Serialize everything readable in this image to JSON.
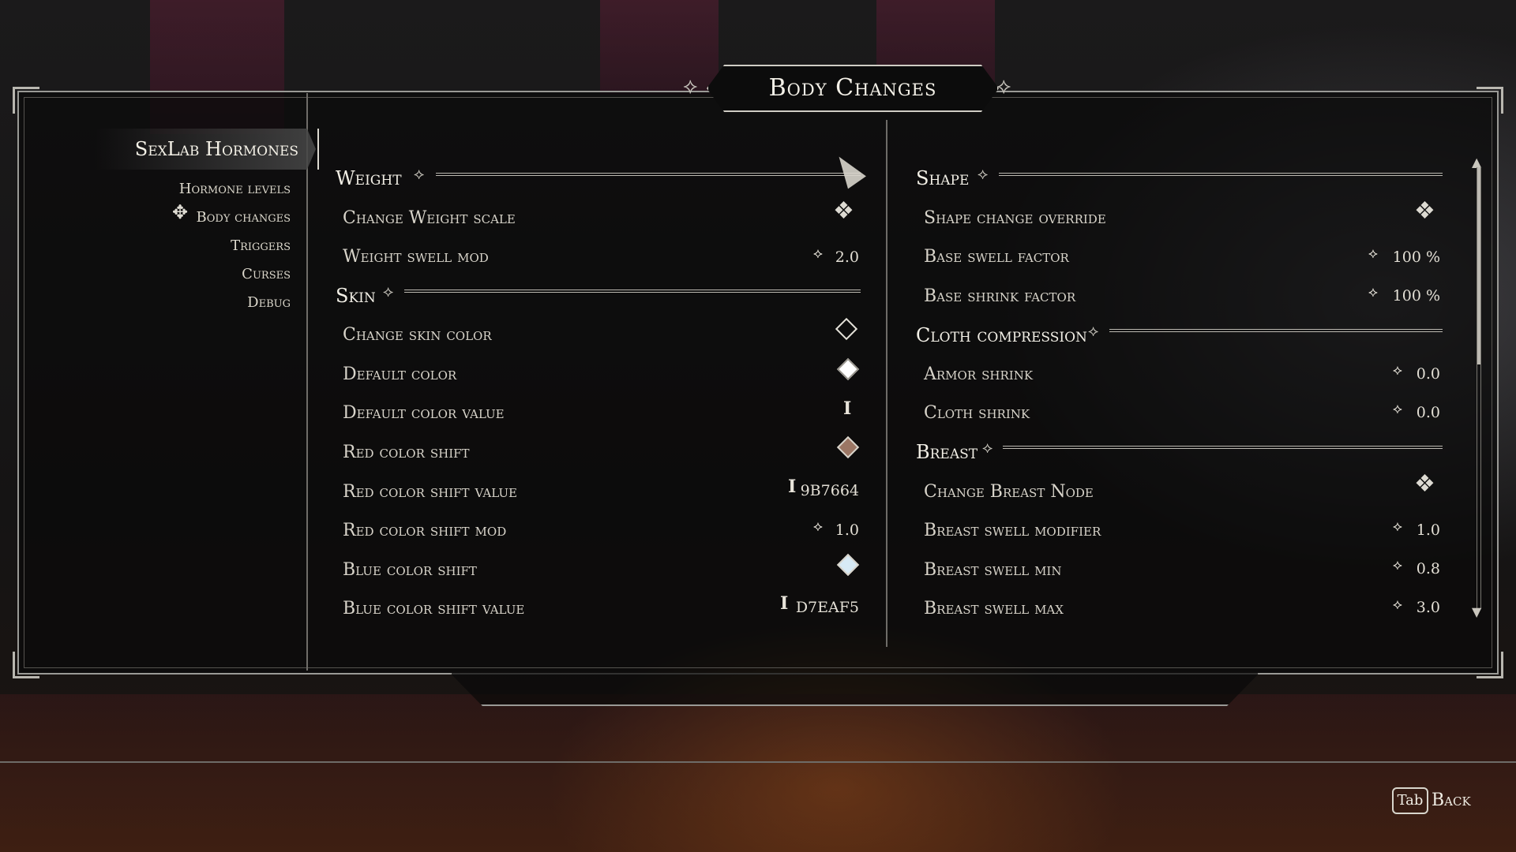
{
  "title": "Body Changes",
  "sidebar": {
    "active_mod": "SexLab Hormones",
    "pages": [
      "Hormone levels",
      "Body changes",
      "Triggers",
      "Curses",
      "Debug"
    ]
  },
  "left": {
    "weight": {
      "header": "Weight",
      "options": [
        {
          "label": "Change Weight scale",
          "value": ""
        },
        {
          "label": "Weight swell mod",
          "value": "2.0"
        }
      ]
    },
    "skin": {
      "header": "Skin",
      "options": [
        {
          "label": "Change skin color",
          "value": ""
        },
        {
          "label": "Default color",
          "value": ""
        },
        {
          "label": "Default color value",
          "value": ""
        },
        {
          "label": "Red color shift",
          "value": ""
        },
        {
          "label": "Red color shift value",
          "value": "9B7664"
        },
        {
          "label": "Red color shift mod",
          "value": "1.0"
        },
        {
          "label": "Blue color shift",
          "value": ""
        },
        {
          "label": "Blue color shift value",
          "value": "D7EAF5"
        }
      ]
    }
  },
  "right": {
    "shape": {
      "header": "Shape",
      "options": [
        {
          "label": "Shape change override",
          "value": ""
        },
        {
          "label": "Base swell factor",
          "value": "100 %"
        },
        {
          "label": "Base shrink factor",
          "value": "100 %"
        }
      ]
    },
    "cloth": {
      "header": "Cloth compression",
      "options": [
        {
          "label": "Armor shrink",
          "value": "0.0"
        },
        {
          "label": "Cloth shrink",
          "value": "0.0"
        }
      ]
    },
    "breast": {
      "header": "Breast",
      "options": [
        {
          "label": "Change Breast Node",
          "value": ""
        },
        {
          "label": "Breast swell modifier",
          "value": "1.0"
        },
        {
          "label": "Breast swell min",
          "value": "0.8"
        },
        {
          "label": "Breast swell max",
          "value": "3.0"
        }
      ]
    }
  },
  "footer": {
    "key": "Tab",
    "back_label": "Back"
  },
  "colors": {
    "red_shift_swatch": "#9B7664",
    "blue_shift_swatch": "#D7EAF5",
    "default_color_swatch": "#FFFFFF"
  },
  "icons": {
    "toggle": "knot-toggle-icon",
    "slider": "slider-icon",
    "text_input": "text-cursor-icon",
    "color": "diamond-swatch-icon",
    "menu": "menu-diamond-icon"
  }
}
